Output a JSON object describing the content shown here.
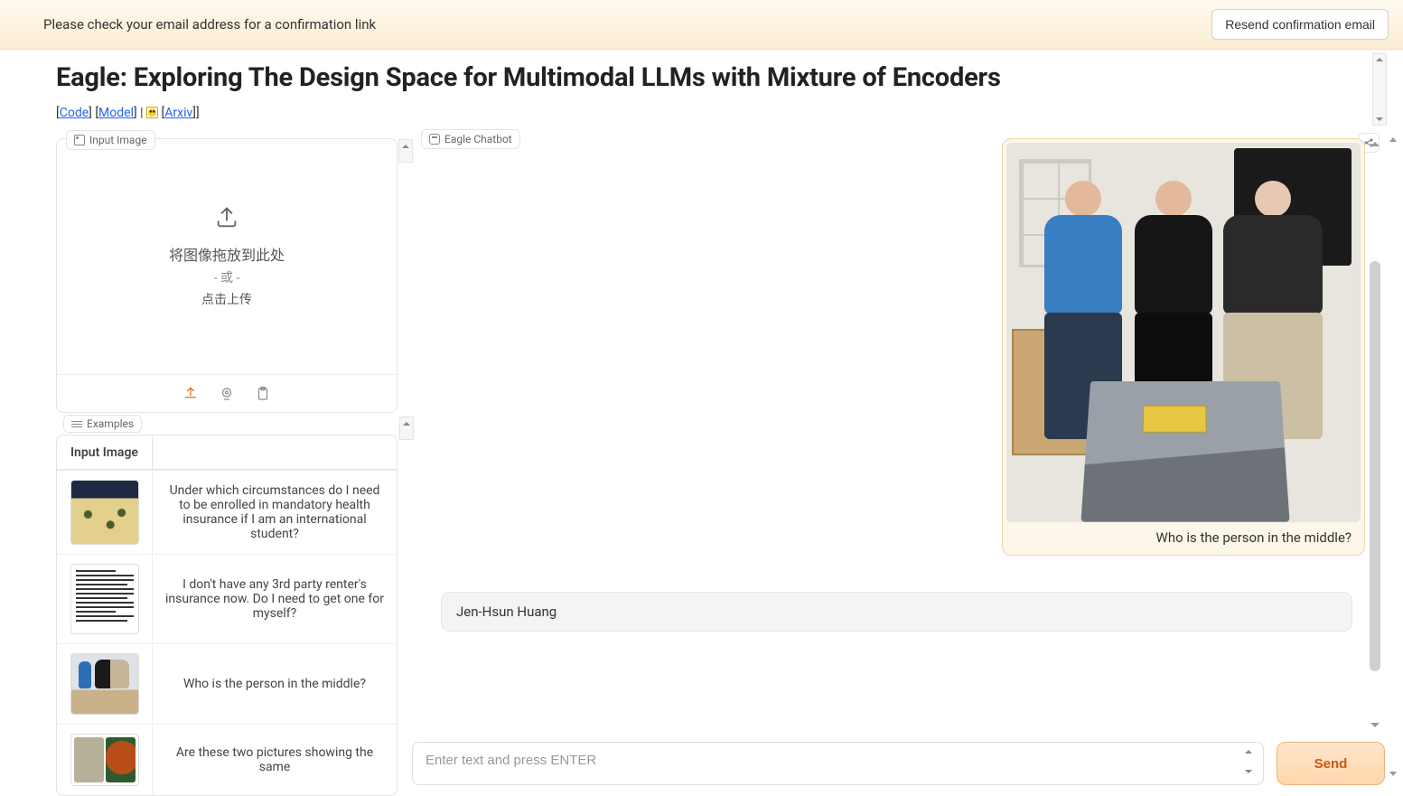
{
  "banner": {
    "text": "Please check your email address for a confirmation link",
    "resend_label": "Resend confirmation email"
  },
  "header": {
    "title": "Eagle: Exploring The Design Space for Multimodal LLMs with Mixture of Encoders",
    "link_code": "Code",
    "link_model": "Model",
    "link_arxiv": "Arxiv"
  },
  "left": {
    "input_image_label": "Input Image",
    "upload_line1": "将图像拖放到此处",
    "upload_line2": "- 或 -",
    "upload_line3": "点击上传",
    "toolbar_upload_name": "upload-file-icon",
    "toolbar_webcam_name": "webcam-icon",
    "toolbar_paste_name": "paste-clipboard-icon",
    "examples_label": "Examples",
    "examples_header_image": "Input Image",
    "examples": [
      {
        "question": "Under which circumstances do I need to be enrolled in mandatory health insurance if I am an international student?"
      },
      {
        "question": "I don't have any 3rd party renter's insurance now. Do I need to get one for myself?"
      },
      {
        "question": "Who is the person in the middle?"
      },
      {
        "question": "Are these two pictures showing the same"
      }
    ]
  },
  "chat": {
    "label": "Eagle Chatbot",
    "user_caption": "Who is the person in the middle?",
    "assistant_reply": "Jen-Hsun Huang"
  },
  "input": {
    "placeholder": "Enter text and press ENTER",
    "send_label": "Send"
  }
}
